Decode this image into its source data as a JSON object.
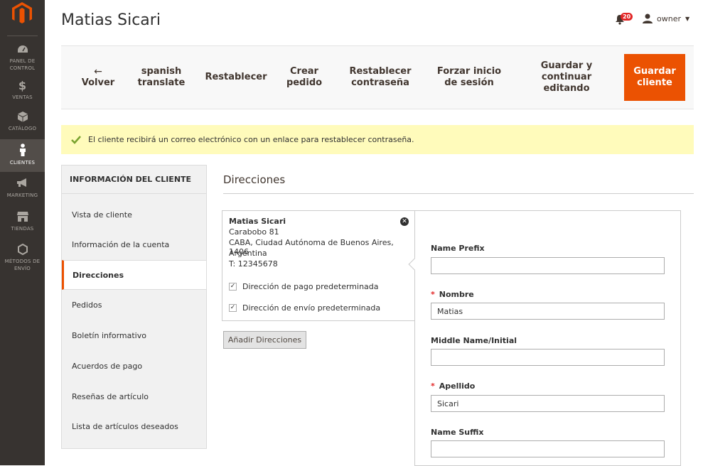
{
  "sidebar": {
    "items": [
      {
        "label": "PANEL DE CONTROL",
        "icon": "dashboard-icon"
      },
      {
        "label": "VENTAS",
        "icon": "dollar-icon"
      },
      {
        "label": "CATÁLOGO",
        "icon": "box-icon"
      },
      {
        "label": "CLIENTES",
        "icon": "person-icon"
      },
      {
        "label": "MARKETING",
        "icon": "megaphone-icon"
      },
      {
        "label": "TIENDAS",
        "icon": "store-icon"
      },
      {
        "label": "MÉTODOS DE ENVÍO",
        "icon": "hexagon-icon"
      }
    ]
  },
  "header": {
    "title": "Matias Sicari",
    "notifications_count": "20",
    "user": "owner"
  },
  "toolbar": {
    "back": "Volver",
    "translate": "spanish translate",
    "reset": "Restablecer",
    "create_order": "Crear pedido",
    "reset_password": "Restablecer contraseña",
    "force_signin": "Forzar inicio de sesión",
    "save_continue": "Guardar y continuar editando",
    "save": "Guardar cliente"
  },
  "message": "El cliente recibirá un correo electrónico con un enlace para restablecer contraseña.",
  "tabs": {
    "title": "INFORMACIÓN DEL CLIENTE",
    "items": [
      "Vista de cliente",
      "Información de la cuenta",
      "Direcciones",
      "Pedidos",
      "Boletín informativo",
      "Acuerdos de pago",
      "Reseñas de artículo",
      "Lista de artículos deseados"
    ]
  },
  "section": {
    "title": "Direcciones",
    "address": {
      "name": "Matias Sicari",
      "street": "Carabobo 81",
      "city": "CABA, Ciudad Autónoma de Buenos Aires, 1406",
      "country": "Argentina",
      "phone": "T: 12345678",
      "default_billing": "Dirección de pago predeterminada",
      "default_shipping": "Dirección de envío predeterminada"
    },
    "add_button": "Añadir Direcciones"
  },
  "form": {
    "prefix_label": "Name Prefix",
    "prefix_value": "",
    "first_label": "Nombre",
    "first_value": "Matias",
    "middle_label": "Middle Name/Initial",
    "middle_value": "",
    "last_label": "Apellido",
    "last_value": "Sicari",
    "suffix_label": "Name Suffix",
    "suffix_value": ""
  },
  "colors": {
    "accent": "#eb5202",
    "sidebar": "#373330",
    "message_bg": "#fffbbb",
    "success": "#79a22e",
    "badge": "#e22626"
  }
}
